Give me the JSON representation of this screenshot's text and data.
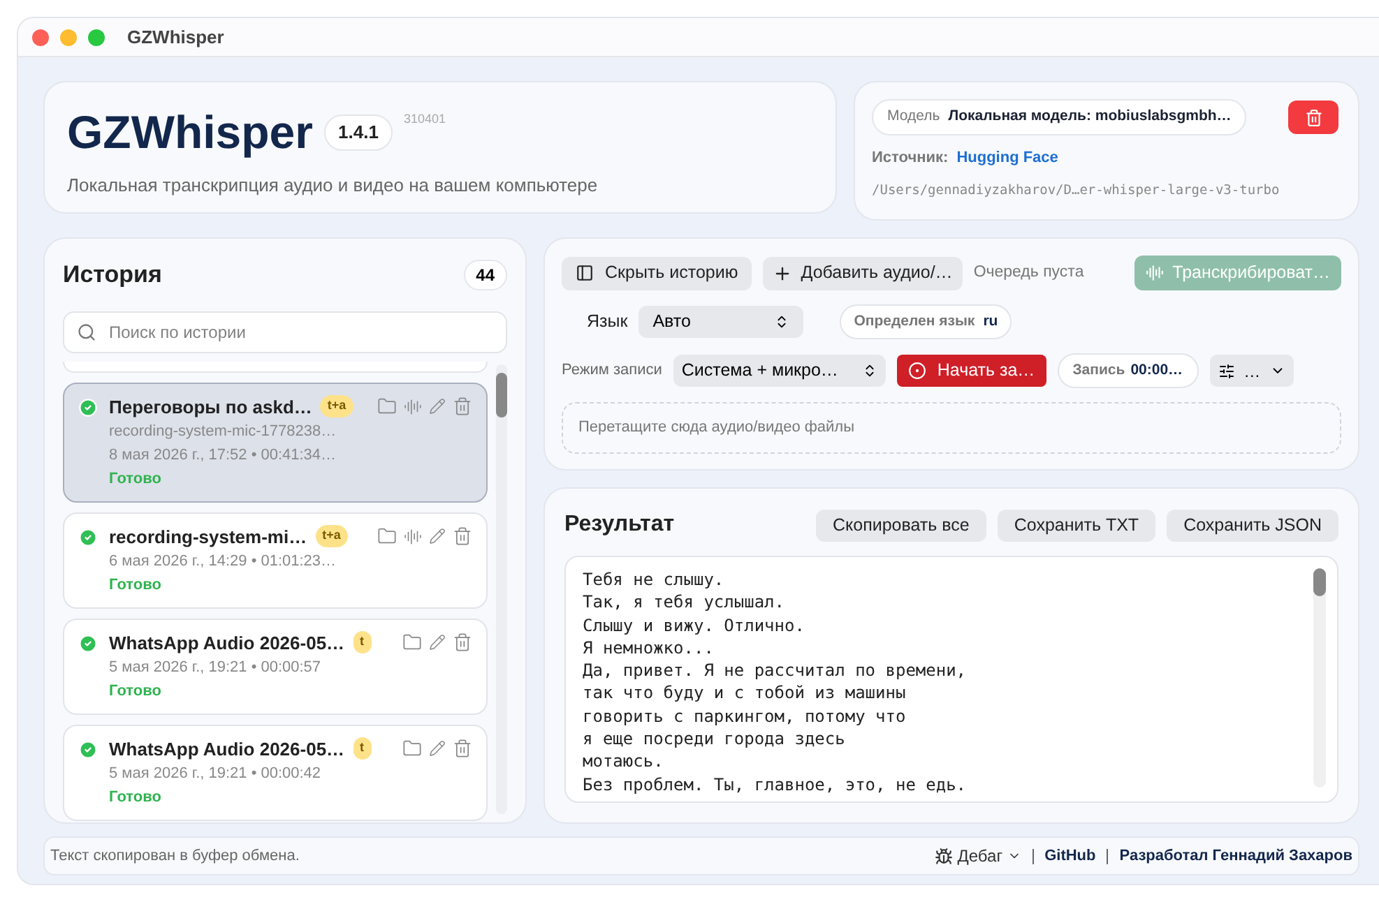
{
  "window": {
    "title": "GZWhisper"
  },
  "header": {
    "app_name": "GZWhisper",
    "version": "1.4.1",
    "build": "310401",
    "subtitle": "Локальная транскрипция аудио и видео на вашем компьютере"
  },
  "model": {
    "label": "Модель",
    "value": "Локальная модель: mobiuslabsgmbh…",
    "source_label": "Источник:",
    "source_link": "Hugging Face",
    "path": "/Users/gennadiyzakharov/D…er-whisper-large-v3-turbo"
  },
  "history": {
    "title": "История",
    "count": "44",
    "search": {
      "placeholder": "Поиск по истории"
    },
    "items": [
      {
        "title": "Переговоры по askd…",
        "tag": "t+a",
        "file": "recording-system-mic-1778238…",
        "meta": "8 мая 2026 г., 17:52 • 00:41:34…",
        "status": "Готово",
        "selected": true,
        "waveform": true
      },
      {
        "title": "recording-system-mi…",
        "tag": "t+a",
        "meta": "6 мая 2026 г., 14:29 • 01:01:23…",
        "status": "Готово",
        "selected": false,
        "waveform": true
      },
      {
        "title": "WhatsApp Audio 2026-05…",
        "tag": "t",
        "meta": "5 мая 2026 г., 19:21 • 00:00:57",
        "status": "Готово",
        "selected": false,
        "waveform": false
      },
      {
        "title": "WhatsApp Audio 2026-05…",
        "tag": "t",
        "meta": "5 мая 2026 г., 19:21 • 00:00:42",
        "status": "Готово",
        "selected": false,
        "waveform": false
      }
    ]
  },
  "controls": {
    "hide_history": "Скрыть историю",
    "add_audio": "Добавить аудио/…",
    "queue": "Очередь пуста",
    "transcribe": {
      "label": "Транскрибироват…",
      "disabled": true
    },
    "language_label": "Язык",
    "language": "Авто",
    "detected_label": "Определен язык",
    "detected": "ru",
    "mode_label": "Режим записи",
    "mode": "Система + микро…",
    "record": "Начать за…",
    "timer_label": "Запись",
    "timer": "00:00…",
    "settings": "…",
    "drop_hint": "Перетащите сюда аудио/видео файлы"
  },
  "result": {
    "title": "Результат",
    "buttons": [
      "Скопировать все",
      "Сохранить TXT",
      "Сохранить JSON"
    ],
    "lines": [
      "Тебя не слышу.",
      "Так, я тебя услышал.",
      "Слышу и вижу. Отлично.",
      "Я немножко...",
      "Да, привет. Я не рассчитал по времени,",
      "так что буду и с тобой из машины",
      "говорить с паркингом, потому что",
      "я еще посреди города здесь",
      "мотаюсь.",
      "Без проблем. Ты, главное, это, не едь."
    ]
  },
  "status_bar": {
    "message": "Текст скопирован в буфер обмена.",
    "debug": "Дебаг",
    "github": "GitHub",
    "author": "Разработал Геннадий Захаров"
  }
}
